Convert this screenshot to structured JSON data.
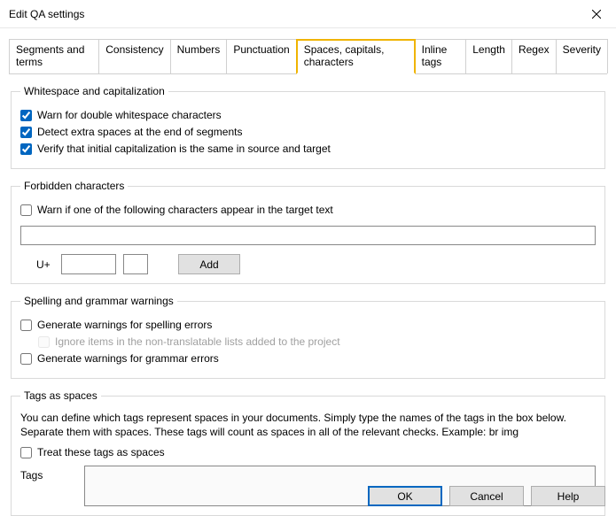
{
  "window": {
    "title": "Edit QA settings"
  },
  "tabs": [
    "Segments and terms",
    "Consistency",
    "Numbers",
    "Punctuation",
    "Spaces, capitals, characters",
    "Inline tags",
    "Length",
    "Regex",
    "Severity"
  ],
  "group_whitespace": {
    "legend": "Whitespace and capitalization",
    "opt_double_whitespace": "Warn for double whitespace characters",
    "opt_extra_spaces_end": "Detect extra spaces at the end of segments",
    "opt_capitalization": "Verify that initial capitalization is the same in source and target"
  },
  "group_forbidden": {
    "legend": "Forbidden characters",
    "opt_warn": "Warn if one of the following characters appear in the target text",
    "chars_value": "",
    "uplus_label": "U+",
    "code_value": "",
    "char_value": "",
    "add_label": "Add"
  },
  "group_spelling": {
    "legend": "Spelling and grammar warnings",
    "opt_spelling": "Generate warnings for spelling errors",
    "opt_ignore_nontranslatable": "Ignore items in the non-translatable lists added to the project",
    "opt_grammar": "Generate warnings for grammar errors"
  },
  "group_tags": {
    "legend": "Tags as spaces",
    "description": "You can define which tags represent spaces in your documents. Simply type the names of the tags in the box below. Separate them with spaces. These tags will count as spaces in all of the relevant checks. Example: br img",
    "opt_treat": "Treat these tags as spaces",
    "tags_label": "Tags",
    "tags_value": ""
  },
  "footer": {
    "ok": "OK",
    "cancel": "Cancel",
    "help": "Help"
  }
}
